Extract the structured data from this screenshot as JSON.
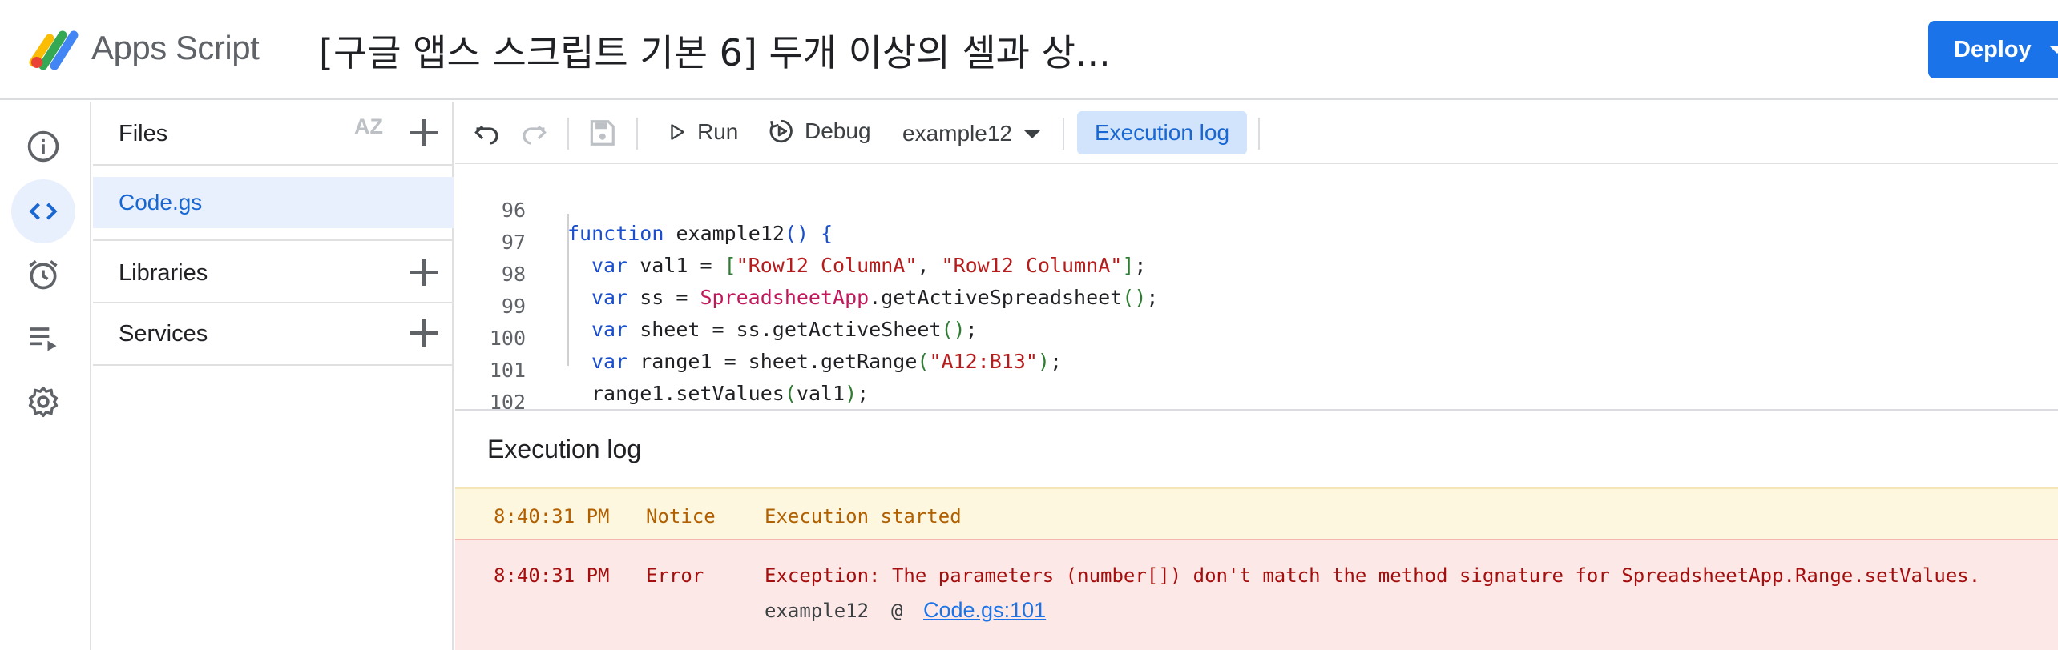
{
  "header": {
    "brand": "Apps Script",
    "project_title": "[구글 앱스 스크립트 기본 6] 두개 이상의 셀과 상...",
    "deploy_label": "Deploy"
  },
  "files_panel": {
    "files_label": "Files",
    "sort_label": "AZ",
    "file_name": "Code.gs",
    "libraries_label": "Libraries",
    "services_label": "Services"
  },
  "toolbar": {
    "run_label": "Run",
    "debug_label": "Debug",
    "function_name": "example12",
    "execution_log_label": "Execution log"
  },
  "editor": {
    "line_numbers": [
      "96",
      "97",
      "98",
      "99",
      "100",
      "101",
      "102"
    ],
    "lines": {
      "l96": {
        "kw": "function",
        "rest": " example12",
        "paren": "()",
        "brace": " {"
      },
      "l97": {
        "kw": "var",
        "name": " val1 = ",
        "open": "[",
        "s1": "\"Row12 ColumnA\"",
        "comma": ", ",
        "s2": "\"Row12 ColumnA\"",
        "close": "]",
        "end": ";"
      },
      "l98": {
        "kw": "var",
        "name": " ss = ",
        "cls": "SpreadsheetApp",
        "method": ".getActiveSpreadsheet",
        "paren": "()",
        "end": ";"
      },
      "l99": {
        "kw": "var",
        "name": " sheet = ss.getActiveSheet",
        "paren": "()",
        "end": ";"
      },
      "l100": {
        "kw": "var",
        "name": " range1 = sheet.getRange",
        "open": "(",
        "str": "\"A12:B13\"",
        "close": ")",
        "end": ";"
      },
      "l101": {
        "name": "range1.setValues",
        "open": "(",
        "arg": "val1",
        "close": ")",
        "end": ";"
      },
      "l102": {
        "brace": "}"
      }
    }
  },
  "log": {
    "title": "Execution log",
    "entries": [
      {
        "time": "8:40:31 PM",
        "level": "Notice",
        "message": "Execution started"
      },
      {
        "time": "8:40:31 PM",
        "level": "Error",
        "message": "Exception: The parameters (number[]) don't match the method signature for SpreadsheetApp.Range.setValues.",
        "trace_fn": "example12",
        "trace_at": "@",
        "trace_link": "Code.gs:101"
      }
    ]
  },
  "colors": {
    "accent": "#1a73e8",
    "notice_bg": "#fef7e0",
    "error_bg": "#fce8e6"
  },
  "icons": [
    "apps-script-logo",
    "info-icon",
    "code-icon",
    "alarm-clock-icon",
    "executions-icon",
    "gear-icon",
    "sort-az-icon",
    "plus-icon",
    "undo-icon",
    "redo-icon",
    "save-icon",
    "play-icon",
    "debug-icon",
    "dropdown-caret-icon"
  ]
}
